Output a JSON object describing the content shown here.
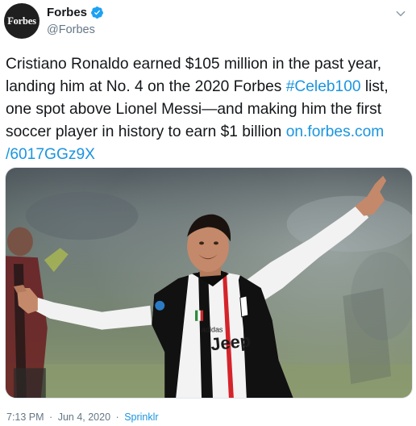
{
  "account": {
    "avatar_text": "Forbes",
    "display_name": "Forbes",
    "handle": "@Forbes",
    "verified": true
  },
  "tweet": {
    "text_segments": {
      "s1": "Cristiano Ronaldo earned $105 million in the past year,",
      "s2": "landing him at No. 4 on the 2020 Forbes ",
      "hashtag": "#Celeb100",
      "s3": " list,",
      "s4": "one spot above Lionel Messi—and making him the first",
      "s5": "soccer player in history to earn $1 billion ",
      "link_part1": "on.forbes.com",
      "link_part2": "/6017GGz9X"
    },
    "media": {
      "kit_sponsor_text": "Jeep",
      "kit_brand_text": "adidas"
    }
  },
  "meta": {
    "time": "7:13 PM",
    "date": "Jun 4, 2020",
    "separator": "·",
    "source": "Sprinklr"
  },
  "colors": {
    "link": "#1b95e0",
    "secondary_text": "#657786",
    "verified_badge": "#1da1f2",
    "jersey_black": "#111111",
    "jersey_white": "#f3f3f3",
    "jersey_stripe": "#d5232a"
  },
  "icons": {
    "verified": "verified-badge-icon",
    "menu": "chevron-down-icon"
  }
}
